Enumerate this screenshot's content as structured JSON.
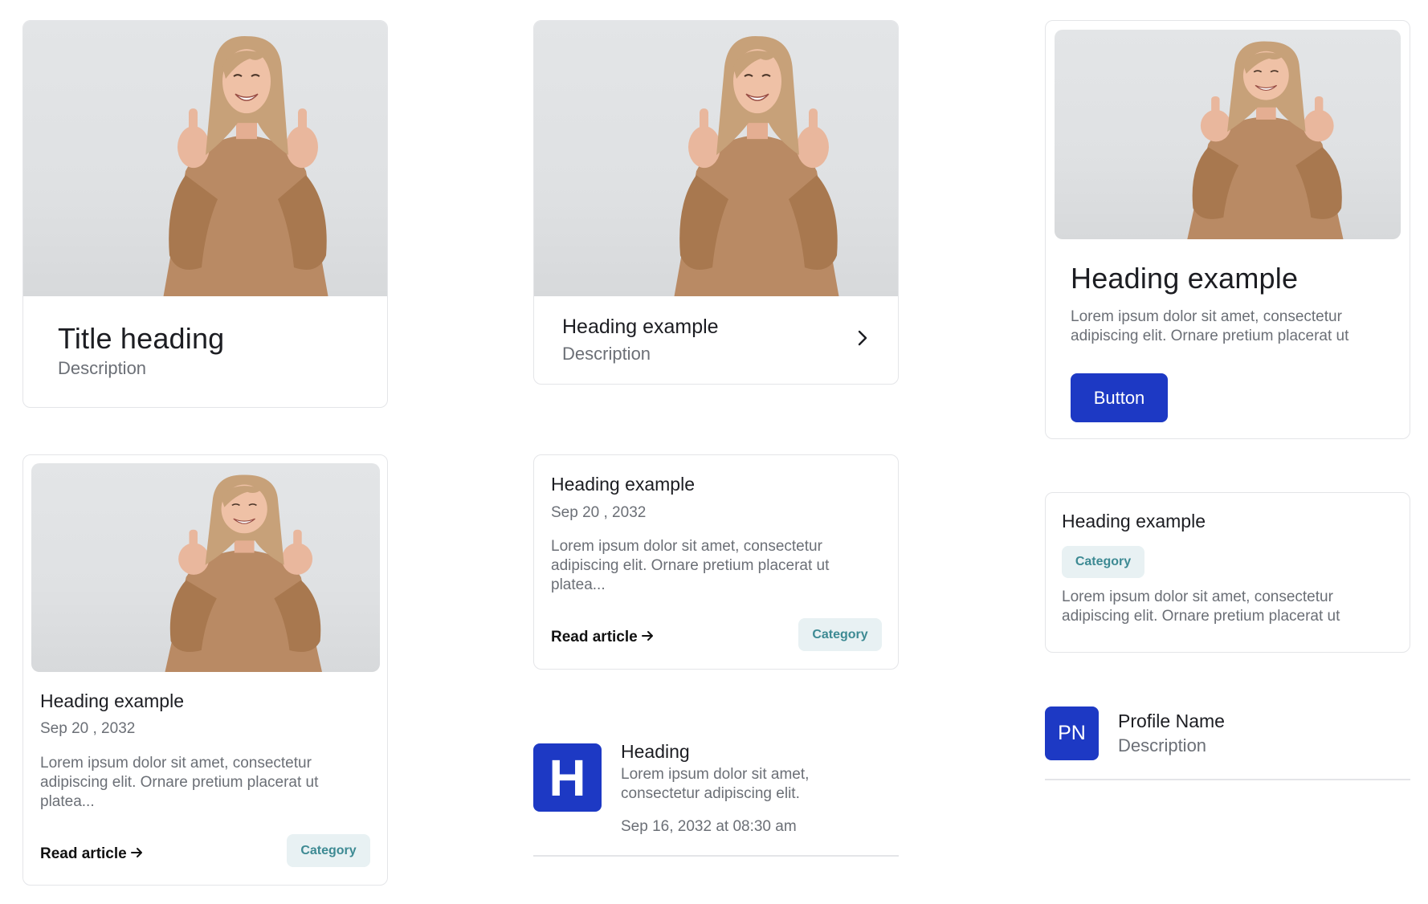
{
  "colors": {
    "accent": "#1d39c4",
    "badge_bg": "#e8f1f3",
    "badge_text": "#3d8a93",
    "border": "#e4e5e8",
    "muted_text": "#6b6f76"
  },
  "card1": {
    "title": "Title heading",
    "description": "Description"
  },
  "card2": {
    "title": "Heading example",
    "description": "Description",
    "chevron_icon": "chevron-right-icon"
  },
  "card3": {
    "title": "Heading example",
    "text": "Lorem ipsum dolor sit amet, consectetur adipiscing elit. Ornare pretium placerat ut",
    "button": "Button"
  },
  "card4": {
    "title": "Heading example",
    "date": "Sep 20 , 2032",
    "text": "Lorem ipsum dolor sit amet, consectetur adipiscing elit. Ornare pretium placerat ut platea...",
    "read_more": "Read article",
    "arrow_icon": "arrow-right-icon",
    "category": "Category"
  },
  "card5": {
    "title": "Heading example",
    "date": "Sep 20 , 2032",
    "text": "Lorem ipsum dolor sit amet, consectetur adipiscing elit. Ornare pretium placerat ut platea...",
    "read_more": "Read article",
    "arrow_icon": "arrow-right-icon",
    "category": "Category"
  },
  "card6": {
    "title": "Heading example",
    "category": "Category",
    "text": "Lorem ipsum dolor sit amet, consectetur adipiscing elit. Ornare pretium placerat ut"
  },
  "list_item": {
    "tile_letter": "H",
    "title": "Heading",
    "text": "Lorem ipsum dolor sit amet, consectetur adipiscing elit.",
    "timestamp": "Sep 16, 2032 at 08:30 am"
  },
  "profile": {
    "initials": "PN",
    "name": "Profile Name",
    "description": "Description"
  }
}
